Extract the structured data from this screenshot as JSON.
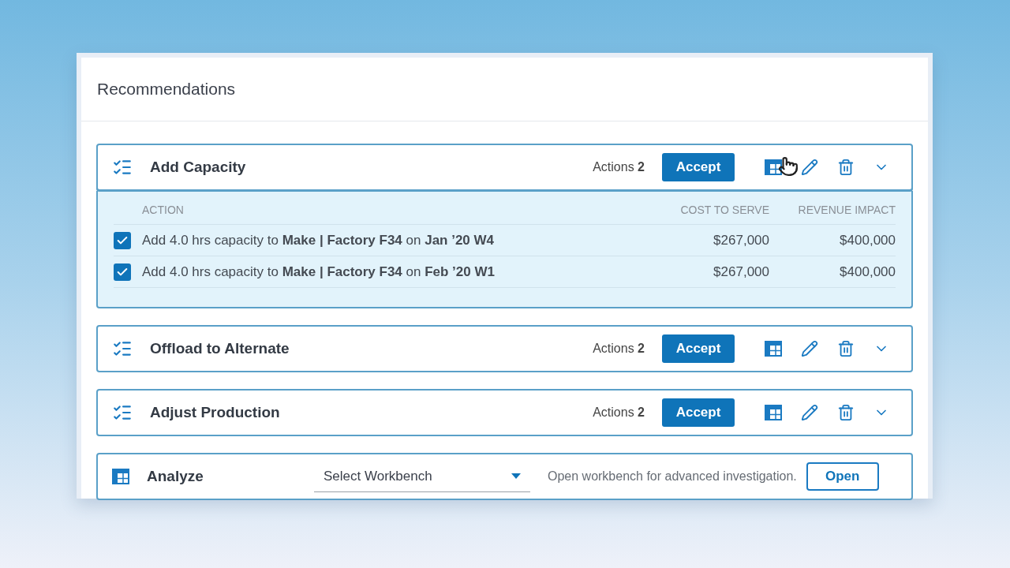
{
  "panel": {
    "title": "Recommendations"
  },
  "groups": [
    {
      "title": "Add Capacity",
      "actions": "Actions **2**",
      "accept": "Accept",
      "expanded": true,
      "cursor": true,
      "columns": [
        "ACTION",
        "COST TO SERVE",
        "REVENUE IMPACT"
      ],
      "rows": [
        {
          "checked": true,
          "action": "Add 4.0 hrs capacity to **Make | Factory F34** on **Jan ’20 W4**",
          "cost": "$267,000",
          "revenue": "$400,000"
        },
        {
          "checked": true,
          "action": "Add 4.0 hrs capacity to **Make | Factory F34** on **Feb ’20 W1**",
          "cost": "$267,000",
          "revenue": "$400,000"
        }
      ]
    },
    {
      "title": "Offload to Alternate",
      "actions": "Actions **2**",
      "accept": "Accept",
      "expanded": false,
      "cursor": false
    },
    {
      "title": "Adjust Production",
      "actions": "Actions **2**",
      "accept": "Accept",
      "expanded": false,
      "cursor": false
    }
  ],
  "analyze": {
    "title": "Analyze",
    "select": "Select Workbench",
    "hint": "Open workbench for advanced investigation.",
    "button": "Open"
  }
}
